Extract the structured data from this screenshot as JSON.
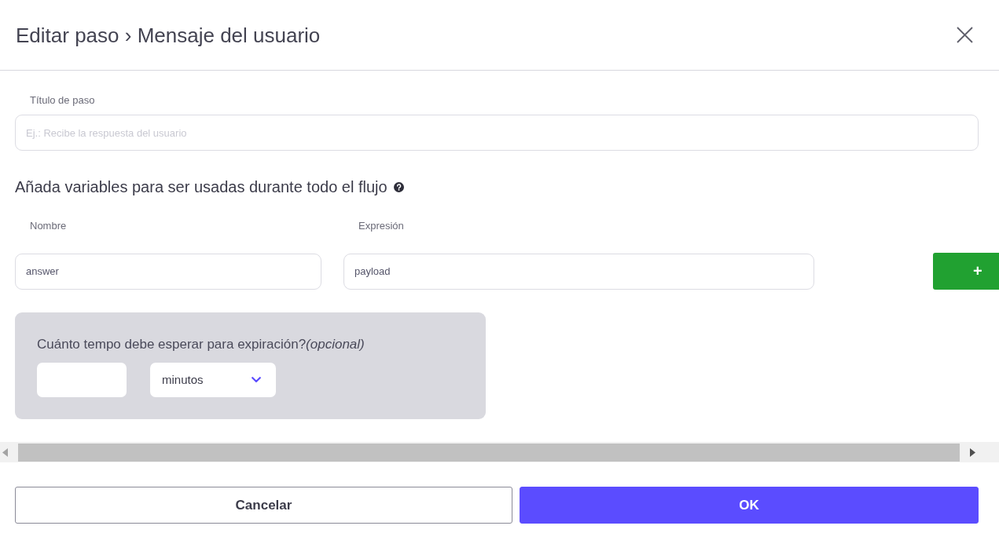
{
  "dialog": {
    "title": "Editar paso › Mensaje del usuario"
  },
  "step_title": {
    "label": "Título de paso",
    "placeholder": "Ej.: Recibe la respuesta del usuario"
  },
  "variables": {
    "heading": "Añada variables para ser usadas durante todo el flujo",
    "columns": [
      "Nombre",
      "Expresión"
    ],
    "rows": [
      {
        "name": "answer",
        "expression": "payload"
      }
    ],
    "add_button": "+"
  },
  "expiration": {
    "question": "Cuánto tempo debe esperar para expiración?*(opcional)*",
    "unit": "minutos"
  },
  "buttons": [
    {
      "label": "Cancelar",
      "kind": "secondary"
    },
    {
      "label": "OK",
      "kind": "primary"
    }
  ]
}
